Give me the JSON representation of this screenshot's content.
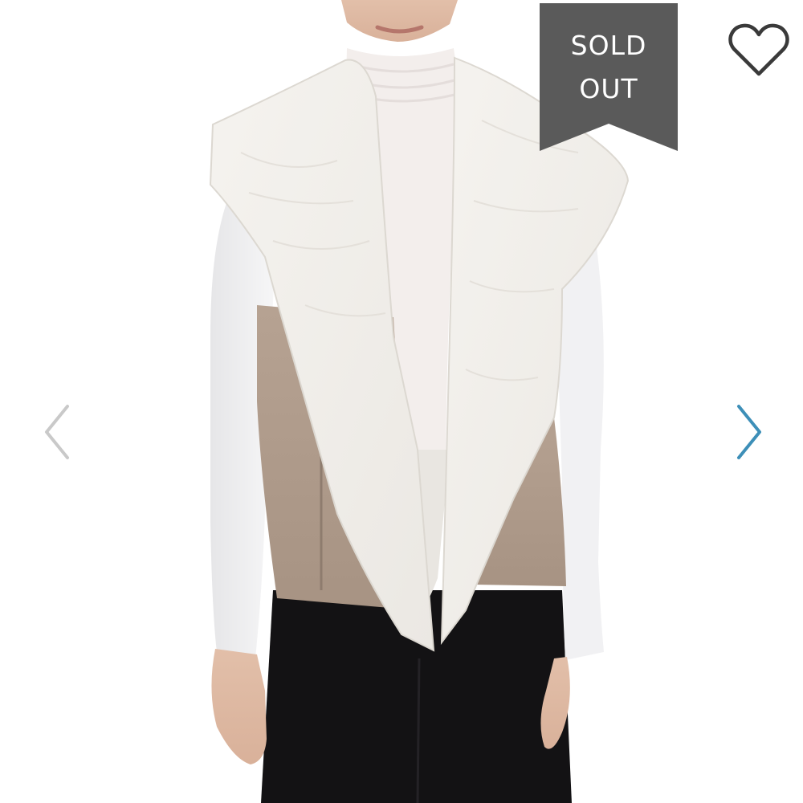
{
  "badge": {
    "line1": "SOLD",
    "line2": "OUT",
    "color": "#5a5a5a"
  },
  "icons": {
    "favorite": "heart-outline-icon",
    "previous": "chevron-left-icon",
    "next": "chevron-right-icon"
  },
  "colors": {
    "background": "#ffffff",
    "next_arrow": "#3d8fb8",
    "prev_arrow": "#c9c9c9",
    "heart_outline": "#3a3a3a"
  }
}
